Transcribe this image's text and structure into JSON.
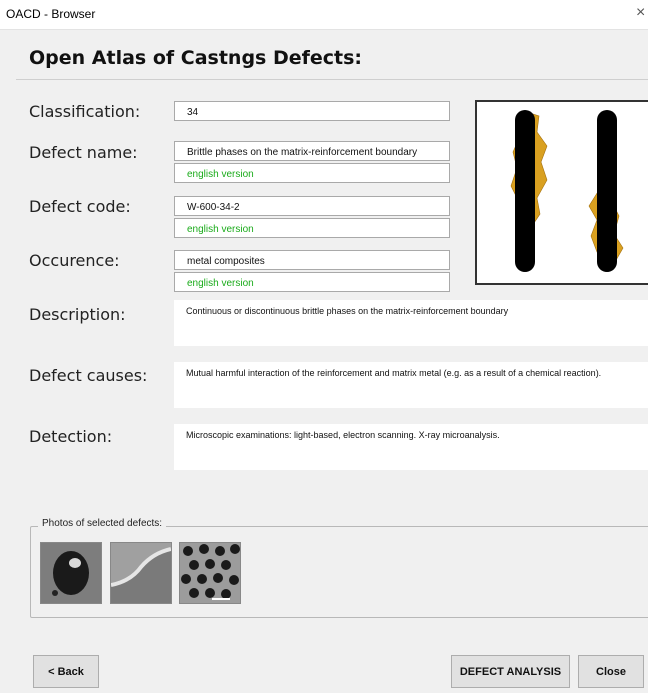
{
  "window": {
    "title": "OACD - Browser",
    "close_glyph": "×"
  },
  "heading": "Open Atlas of Castngs Defects:",
  "fields": {
    "classification": {
      "label": "Classification:",
      "value": "34"
    },
    "defect_name": {
      "label": "Defect name:",
      "value": "Brittle phases on the matrix-reinforcement boundary",
      "english": "english version"
    },
    "defect_code": {
      "label": "Defect code:",
      "value": "W-600-34-2",
      "english": "english version"
    },
    "occurence": {
      "label": "Occurence:",
      "value": "metal composites",
      "english": "english version"
    }
  },
  "description": {
    "label": "Description:",
    "value": "Continuous or discontinuous brittle phases on the matrix-reinforcement boundary"
  },
  "causes": {
    "label": "Defect causes:",
    "value": "Mutual harmful interaction of the reinforcement and matrix metal (e.g. as a result of a chemical reaction)."
  },
  "detection": {
    "label": "Detection:",
    "value": "Microscopic examinations: light-based, electron scanning. X-ray microanalysis."
  },
  "photos": {
    "title": "Photos of selected defects:"
  },
  "buttons": {
    "back": "< Back",
    "analysis": "DEFECT ANALYSIS",
    "close": "Close"
  },
  "colors": {
    "english_text": "#1aab1a",
    "defect_fill": "#d9a020",
    "fiber": "#000000"
  }
}
